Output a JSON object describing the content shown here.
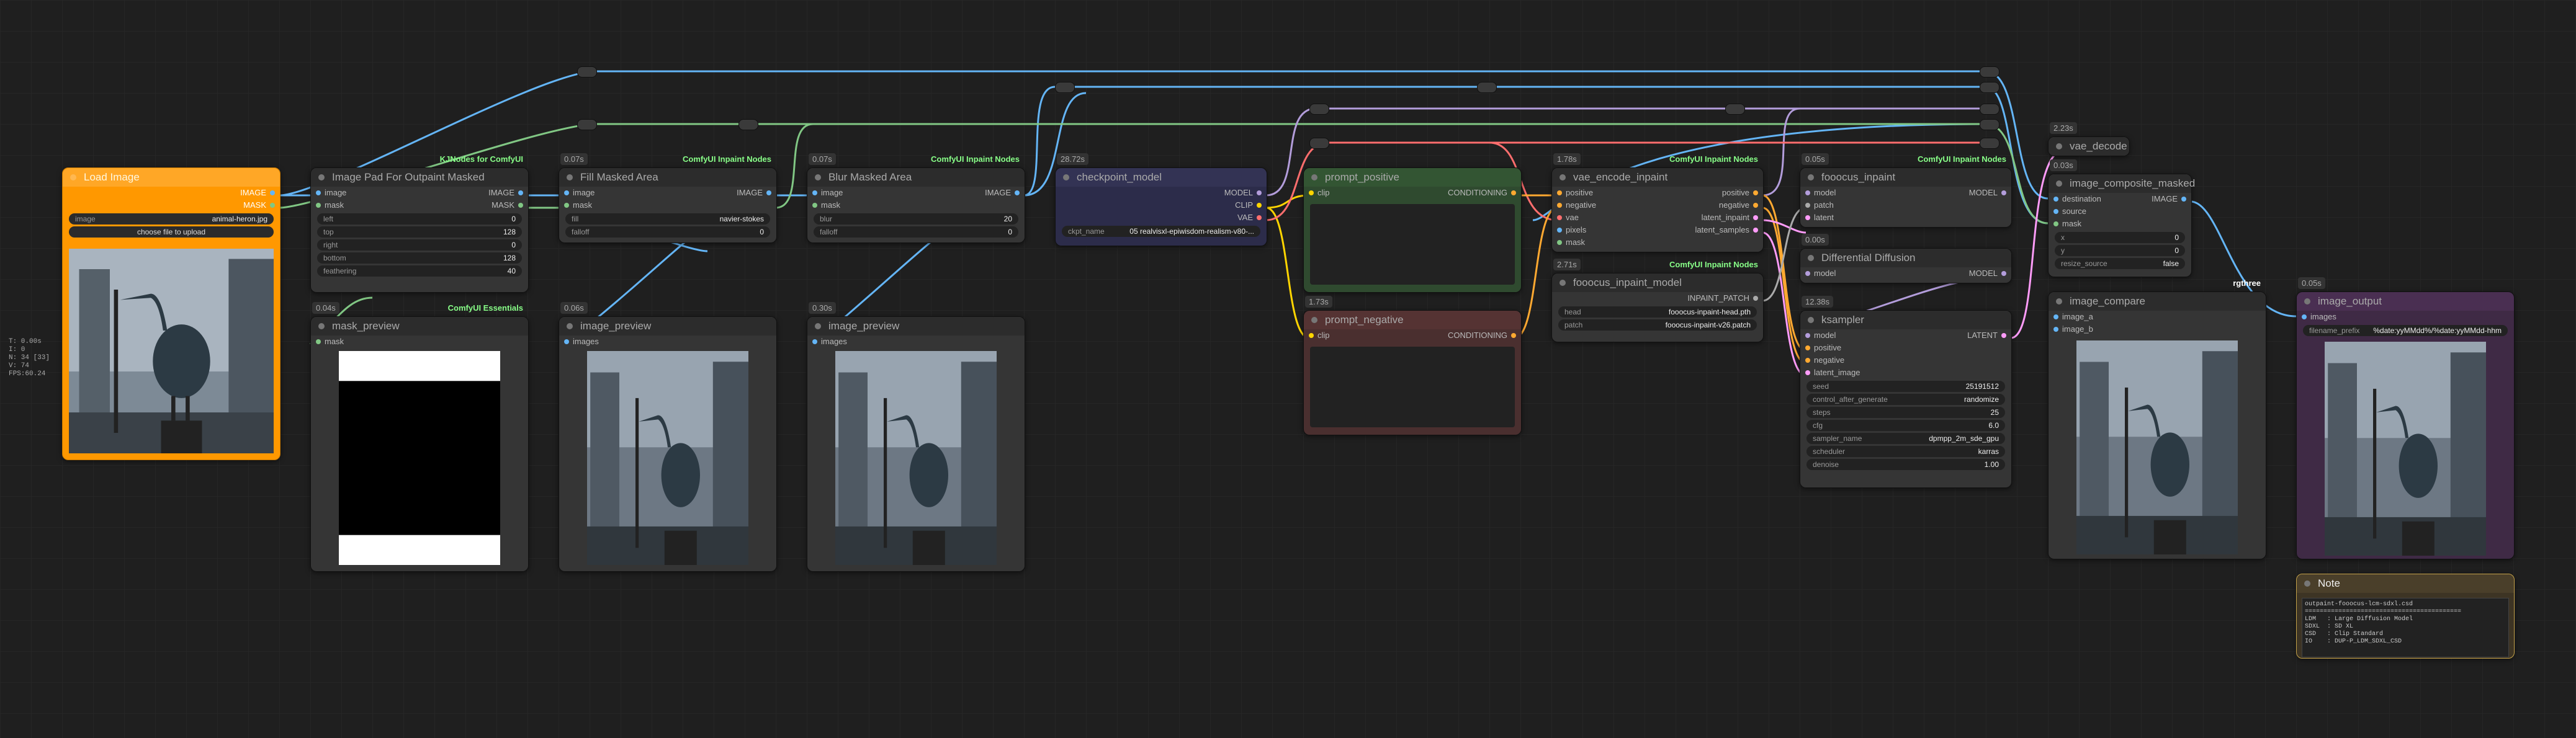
{
  "stats": [
    "T: 0.00s",
    "I: 0",
    "N: 34 [33]",
    "V: 74",
    "FPS:60.24"
  ],
  "colors": {
    "image": "#64b5f6",
    "mask": "#81c784",
    "model": "#b39ddb",
    "clip": "#ffd500",
    "vae": "#ff6e6e",
    "conditioning": "#ffa931",
    "latent": "#ff9cf9",
    "patch": "#aaaaaa"
  },
  "load_image": {
    "title": "Load Image",
    "out_image": "IMAGE",
    "out_mask": "MASK",
    "image_label": "image",
    "image_value": "animal-heron.jpg",
    "upload": "choose file to upload"
  },
  "image_pad": {
    "title": "Image Pad For Outpaint Masked",
    "badge": "KJNodes for ComfyUI",
    "in_image": "image",
    "in_mask": "mask",
    "out_image": "IMAGE",
    "out_mask": "MASK",
    "widgets": [
      {
        "k": "left",
        "v": "0"
      },
      {
        "k": "top",
        "v": "128"
      },
      {
        "k": "right",
        "v": "0"
      },
      {
        "k": "bottom",
        "v": "128"
      },
      {
        "k": "feathering",
        "v": "40"
      }
    ]
  },
  "fill_masked": {
    "time": "0.07s",
    "title": "Fill Masked Area",
    "badge": "ComfyUI Inpaint Nodes",
    "in_image": "image",
    "in_mask": "mask",
    "out": "IMAGE",
    "widgets": [
      {
        "k": "fill",
        "v": "navier-stokes"
      },
      {
        "k": "falloff",
        "v": "0"
      }
    ]
  },
  "blur_masked": {
    "time": "0.07s",
    "title": "Blur Masked Area",
    "badge": "ComfyUI Inpaint Nodes",
    "in_image": "image",
    "in_mask": "mask",
    "out": "IMAGE",
    "widgets": [
      {
        "k": "blur",
        "v": "20"
      },
      {
        "k": "falloff",
        "v": "0"
      }
    ]
  },
  "checkpoint": {
    "time": "28.72s",
    "title": "checkpoint_model",
    "out_model": "MODEL",
    "out_clip": "CLIP",
    "out_vae": "VAE",
    "ckpt_label": "ckpt_name",
    "ckpt_value": "05 realvisxl-epiwisdom-realism-v80-..."
  },
  "prompt_positive": {
    "title": "prompt_positive",
    "in": "clip",
    "out": "CONDITIONING"
  },
  "prompt_negative": {
    "time": "1.73s",
    "title": "prompt_negative",
    "in": "clip",
    "out": "CONDITIONING"
  },
  "vae_encode": {
    "time": "1.78s",
    "title": "vae_encode_inpaint",
    "badge": "ComfyUI Inpaint Nodes",
    "inputs": [
      "positive",
      "negative",
      "vae",
      "pixels",
      "mask"
    ],
    "outputs": [
      "positive",
      "negative",
      "latent_inpaint",
      "latent_samples"
    ]
  },
  "fooocus_model": {
    "time": "2.71s",
    "title": "fooocus_inpaint_model",
    "badge": "ComfyUI Inpaint Nodes",
    "out": "INPAINT_PATCH",
    "widgets": [
      {
        "k": "head",
        "v": "fooocus-inpaint-head.pth"
      },
      {
        "k": "patch",
        "v": "fooocus-inpaint-v26.patch"
      }
    ]
  },
  "fooocus_inpaint": {
    "time": "0.05s",
    "title": "fooocus_inpaint",
    "badge": "ComfyUI Inpaint Nodes",
    "in_model": "model",
    "in_patch": "patch",
    "in_latent": "latent",
    "out": "MODEL"
  },
  "diff_diffusion": {
    "time": "0.00s",
    "title": "Differential Diffusion",
    "in": "model",
    "out": "MODEL"
  },
  "ksampler": {
    "time": "12.38s",
    "title": "ksampler",
    "inputs": [
      "model",
      "positive",
      "negative",
      "latent_image"
    ],
    "out": "LATENT",
    "widgets": [
      {
        "k": "seed",
        "v": "25191512"
      },
      {
        "k": "control_after_generate",
        "v": "randomize"
      },
      {
        "k": "steps",
        "v": "25"
      },
      {
        "k": "cfg",
        "v": "6.0"
      },
      {
        "k": "sampler_name",
        "v": "dpmpp_2m_sde_gpu"
      },
      {
        "k": "scheduler",
        "v": "karras"
      },
      {
        "k": "denoise",
        "v": "1.00"
      }
    ]
  },
  "vae_decode": {
    "time": "2.23s",
    "title": "vae_decode"
  },
  "composite": {
    "time": "0.03s",
    "title": "image_composite_masked",
    "inputs": [
      "destination",
      "source",
      "mask"
    ],
    "out": "IMAGE",
    "widgets": [
      {
        "k": "x",
        "v": "0"
      },
      {
        "k": "y",
        "v": "0"
      },
      {
        "k": "resize_source",
        "v": "false"
      }
    ]
  },
  "mask_preview": {
    "time": "0.04s",
    "title": "mask_preview",
    "badge": "ComfyUI Essentials",
    "in": "mask"
  },
  "image_preview1": {
    "time": "0.06s",
    "title": "image_preview",
    "in": "images"
  },
  "image_preview2": {
    "time": "0.30s",
    "title": "image_preview",
    "in": "images"
  },
  "image_compare": {
    "title": "image_compare",
    "badge": "rgthree",
    "inputs": [
      "image_a",
      "image_b"
    ]
  },
  "image_output": {
    "time": "0.05s",
    "title": "image_output",
    "in": "images",
    "prefix_label": "filename_prefix",
    "prefix_value": "%date:yyMMdd%/%date:yyMMdd-hhm"
  },
  "note": {
    "title": "Note",
    "text": "outpaint-fooocus-lcm-sdxl.csd\n==========================================\nLDM   : Large Diffusion Model\nSDXL  : SD XL\nCSD   : Clip Standard\nIO    : DUP-P_LDM_SDXL_CSD"
  }
}
